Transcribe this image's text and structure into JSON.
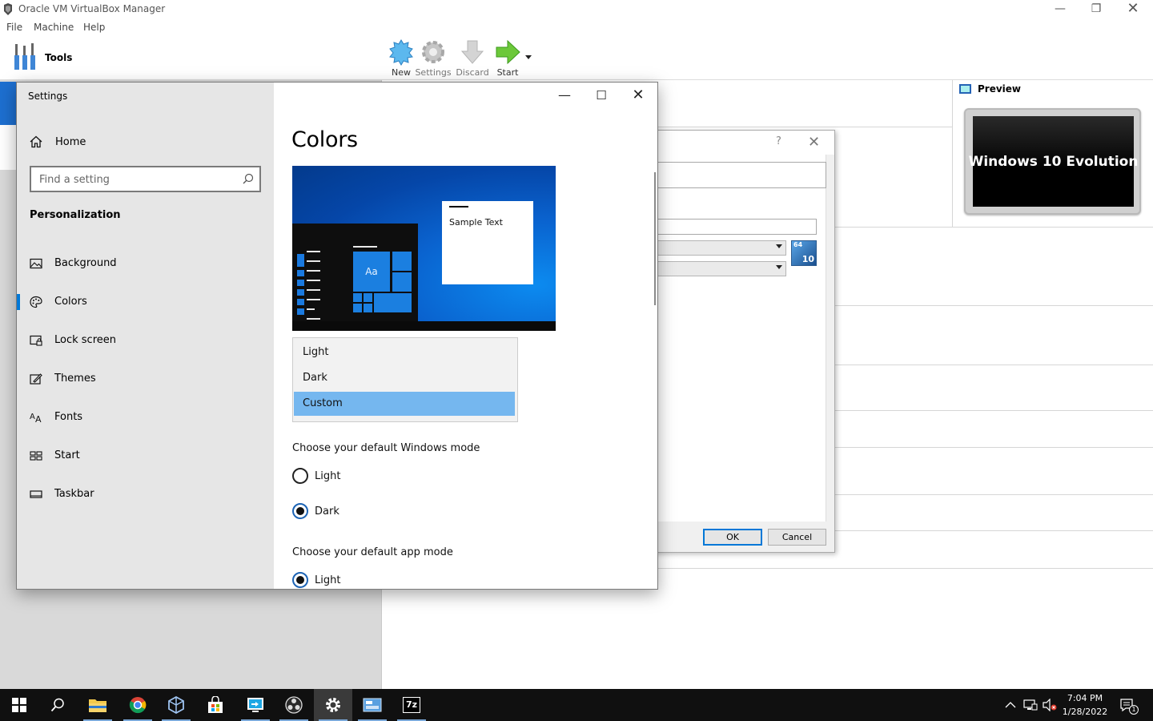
{
  "vbox": {
    "window_title": "Oracle VM VirtualBox Manager",
    "menu": [
      "File",
      "Machine",
      "Help"
    ],
    "tools_label": "Tools",
    "toolbar": {
      "new_label": "New",
      "settings_label": "Settings",
      "discard_label": "Discard",
      "start_label": "Start"
    },
    "preview": {
      "label": "Preview",
      "screen_text": "Windows 10 Evolution"
    },
    "dialog": {
      "help_glyph": "?",
      "ok_label": "OK",
      "cancel_label": "Cancel",
      "os_badge_top": "64",
      "os_badge_bottom": "10"
    }
  },
  "settings": {
    "window_title": "Settings",
    "nav": {
      "home_label": "Home",
      "search_placeholder": "Find a setting",
      "section_header": "Personalization",
      "items": [
        {
          "label": "Background",
          "icon": "picture-icon"
        },
        {
          "label": "Colors",
          "icon": "palette-icon",
          "active": true
        },
        {
          "label": "Lock screen",
          "icon": "lock-screen-icon"
        },
        {
          "label": "Themes",
          "icon": "themes-icon"
        },
        {
          "label": "Fonts",
          "icon": "fonts-icon"
        },
        {
          "label": "Start",
          "icon": "start-icon"
        },
        {
          "label": "Taskbar",
          "icon": "taskbar-icon"
        }
      ]
    },
    "content": {
      "page_title": "Colors",
      "preview_aa": "Aa",
      "preview_sample_text": "Sample Text",
      "color_mode_options": [
        "Light",
        "Dark",
        "Custom"
      ],
      "color_mode_selected": "Custom",
      "windows_mode": {
        "label": "Choose your default Windows mode",
        "options": [
          "Light",
          "Dark"
        ],
        "selected": "Dark"
      },
      "app_mode": {
        "label": "Choose your default app mode",
        "options": [
          "Light"
        ],
        "selected": "Light"
      }
    }
  },
  "taskbar": {
    "apps": [
      "start-icon",
      "search-icon",
      "file-explorer-icon",
      "chrome-icon",
      "virtualbox-icon",
      "store-icon",
      "remote-desktop-icon",
      "obs-icon",
      "settings-icon",
      "control-panel-icon",
      "7zip-icon"
    ],
    "active_app": "settings-icon",
    "sevenzip_label": "7z",
    "clock_time": "7:04 PM",
    "clock_date": "1/28/2022",
    "notification_count": "1",
    "accent": "#0078d7"
  }
}
